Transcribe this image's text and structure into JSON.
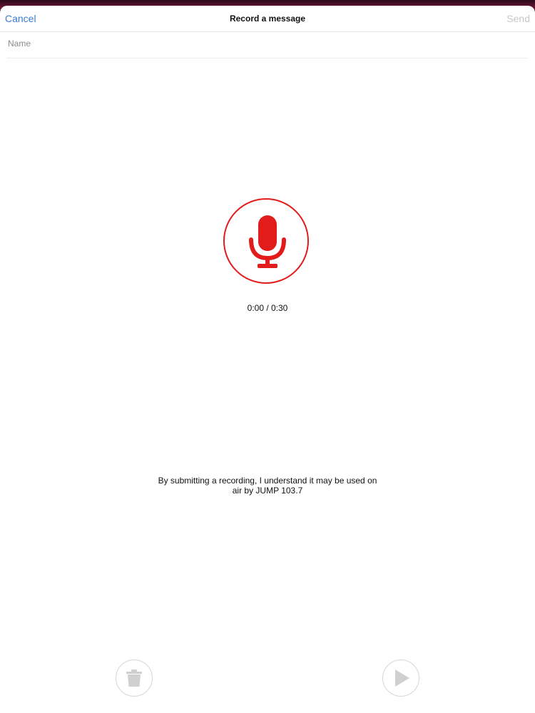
{
  "navbar": {
    "cancel_label": "Cancel",
    "title": "Record a message",
    "send_label": "Send"
  },
  "name_field": {
    "placeholder": "Name",
    "value": ""
  },
  "recorder": {
    "icon": "microphone-icon",
    "timer": "0:00 / 0:30",
    "accent_color": "#e21b1b"
  },
  "disclaimer": {
    "line1": "By submitting a recording, I understand it may be used on",
    "line2": "air by JUMP 103.7"
  },
  "controls": {
    "delete_icon": "trash-icon",
    "play_icon": "play-icon",
    "disabled_color": "#d6d6d6"
  }
}
